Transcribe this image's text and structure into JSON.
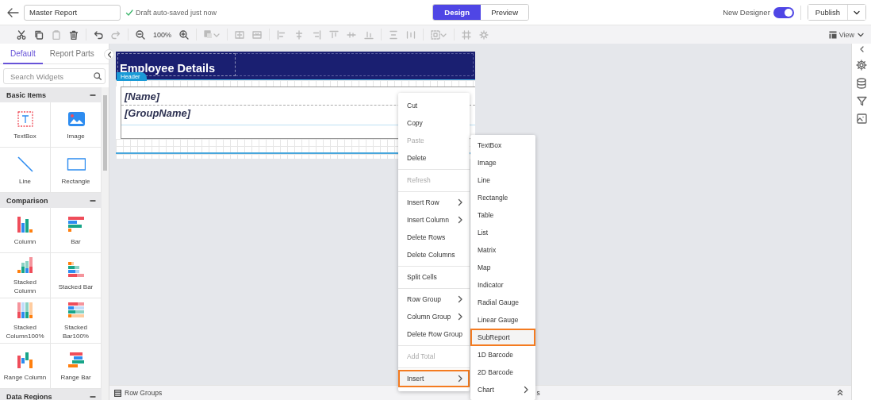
{
  "topbar": {
    "report_name": "Master Report",
    "save_status": "Draft auto-saved just now",
    "modes": [
      {
        "label": "Design",
        "selected": true
      },
      {
        "label": "Preview",
        "selected": false
      }
    ],
    "new_designer": {
      "label": "New Designer",
      "on": true
    },
    "publish_label": "Publish"
  },
  "toolbar": {
    "zoom": "100%",
    "view_label": "View"
  },
  "widget_panel": {
    "tabs": [
      {
        "label": "Default",
        "selected": true
      },
      {
        "label": "Report Parts",
        "selected": false
      }
    ],
    "search": {
      "placeholder": "Search Widgets"
    },
    "sections": [
      {
        "title": "Basic Items",
        "expanded": true,
        "items": [
          {
            "label": "TextBox",
            "kind": "textbox"
          },
          {
            "label": "Image",
            "kind": "image"
          },
          {
            "label": "Line",
            "kind": "line"
          },
          {
            "label": "Rectangle",
            "kind": "rectangle"
          }
        ]
      },
      {
        "title": "Comparison",
        "expanded": true,
        "items": [
          {
            "label": "Column",
            "kind": "column"
          },
          {
            "label": "Bar",
            "kind": "bar"
          },
          {
            "label": "Stacked Column",
            "kind": "stacked-column"
          },
          {
            "label": "Stacked Bar",
            "kind": "stacked-bar"
          },
          {
            "label": "Stacked Column100%",
            "kind": "stacked-column-100"
          },
          {
            "label": "Stacked Bar100%",
            "kind": "stacked-bar-100"
          },
          {
            "label": "Range Column",
            "kind": "range-column"
          },
          {
            "label": "Range Bar",
            "kind": "range-bar"
          }
        ]
      },
      {
        "title": "Data Regions",
        "expanded": true
      }
    ]
  },
  "report": {
    "header_label": "Header",
    "title": "Employee Details",
    "rows": [
      "[Name]",
      "[GroupName]"
    ]
  },
  "context_menu": {
    "groups": [
      [
        {
          "label": "Cut",
          "disabled": false,
          "has_submenu": false,
          "highlighted": false
        },
        {
          "label": "Copy",
          "disabled": false,
          "has_submenu": false,
          "highlighted": false
        },
        {
          "label": "Paste",
          "disabled": true,
          "has_submenu": false,
          "highlighted": false
        },
        {
          "label": "Delete",
          "disabled": false,
          "has_submenu": false,
          "highlighted": false
        }
      ],
      [
        {
          "label": "Refresh",
          "disabled": true,
          "has_submenu": false,
          "highlighted": false
        }
      ],
      [
        {
          "label": "Insert Row",
          "disabled": false,
          "has_submenu": true,
          "highlighted": false
        },
        {
          "label": "Insert Column",
          "disabled": false,
          "has_submenu": true,
          "highlighted": false
        },
        {
          "label": "Delete Rows",
          "disabled": false,
          "has_submenu": false,
          "highlighted": false
        },
        {
          "label": "Delete Columns",
          "disabled": false,
          "has_submenu": false,
          "highlighted": false
        }
      ],
      [
        {
          "label": "Split Cells",
          "disabled": false,
          "has_submenu": false,
          "highlighted": false
        }
      ],
      [
        {
          "label": "Row Group",
          "disabled": false,
          "has_submenu": true,
          "highlighted": false
        },
        {
          "label": "Column Group",
          "disabled": false,
          "has_submenu": true,
          "highlighted": false
        },
        {
          "label": "Delete Row Group",
          "disabled": false,
          "has_submenu": false,
          "highlighted": false
        }
      ],
      [
        {
          "label": "Add Total",
          "disabled": true,
          "has_submenu": false,
          "highlighted": false
        }
      ],
      [
        {
          "label": "Insert",
          "disabled": false,
          "has_submenu": true,
          "highlighted": true
        }
      ]
    ]
  },
  "submenu": {
    "items": [
      {
        "label": "TextBox",
        "has_submenu": false,
        "highlighted": false
      },
      {
        "label": "Image",
        "has_submenu": false,
        "highlighted": false
      },
      {
        "label": "Line",
        "has_submenu": false,
        "highlighted": false
      },
      {
        "label": "Rectangle",
        "has_submenu": false,
        "highlighted": false
      },
      {
        "label": "Table",
        "has_submenu": false,
        "highlighted": false
      },
      {
        "label": "List",
        "has_submenu": false,
        "highlighted": false
      },
      {
        "label": "Matrix",
        "has_submenu": false,
        "highlighted": false
      },
      {
        "label": "Map",
        "has_submenu": false,
        "highlighted": false
      },
      {
        "label": "Indicator",
        "has_submenu": false,
        "highlighted": false
      },
      {
        "label": "Radial Gauge",
        "has_submenu": false,
        "highlighted": false
      },
      {
        "label": "Linear Gauge",
        "has_submenu": false,
        "highlighted": false
      },
      {
        "label": "SubReport",
        "has_submenu": false,
        "highlighted": true
      },
      {
        "label": "1D Barcode",
        "has_submenu": false,
        "highlighted": false
      },
      {
        "label": "2D Barcode",
        "has_submenu": false,
        "highlighted": false
      },
      {
        "label": "Chart",
        "has_submenu": true,
        "highlighted": false
      }
    ]
  },
  "bottom_bar": {
    "row_groups_label": "Row Groups",
    "column_groups_label": "s"
  }
}
